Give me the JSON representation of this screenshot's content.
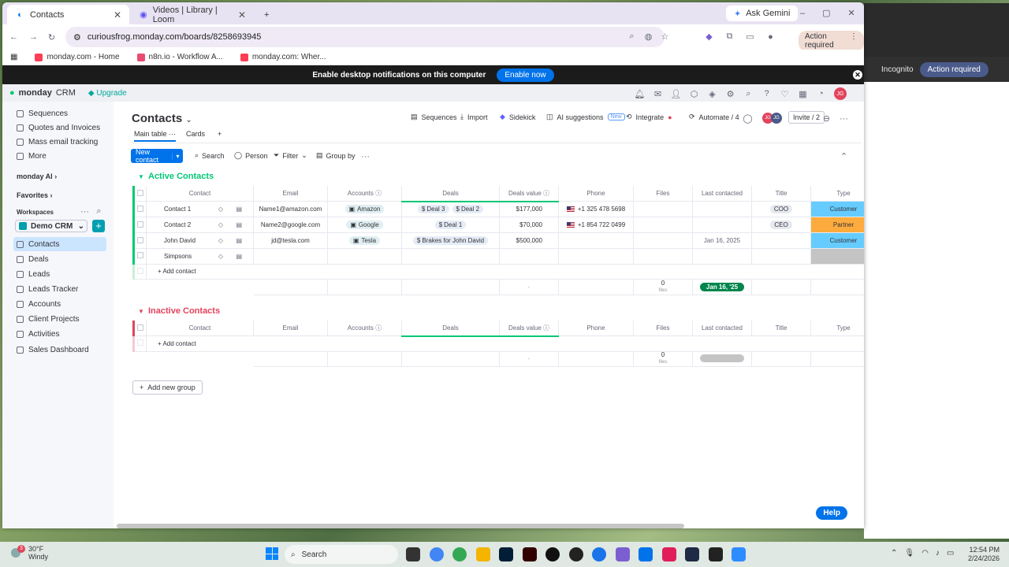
{
  "browser": {
    "tabs": [
      {
        "label": "Contacts"
      },
      {
        "label": "Videos | Library | Loom"
      }
    ],
    "ask_gemini": "Ask Gemini",
    "url": "curiousfrog.monday.com/boards/8258693945",
    "action_required": "Action required",
    "bookmarks": [
      "monday.com - Home",
      "n8n.io - Workflow A...",
      "monday.com: Wher..."
    ]
  },
  "bg_window": {
    "incognito": "Incognito",
    "action_required": "Action required"
  },
  "notification": {
    "text": "Enable desktop notifications on this computer",
    "button": "Enable now"
  },
  "app": {
    "brand": "monday",
    "brand_suffix": "CRM",
    "upgrade": "Upgrade",
    "avatar": "JG"
  },
  "sidebar": {
    "top_items": [
      "Sequences",
      "Quotes and Invoices",
      "Mass email tracking",
      "More"
    ],
    "monday_ai": "monday AI",
    "favorites": "Favorites",
    "workspaces": "Workspaces",
    "workspace_name": "Demo CRM",
    "boards": [
      "Contacts",
      "Deals",
      "Leads",
      "Leads Tracker",
      "Accounts",
      "Client Projects",
      "Activities",
      "Sales Dashboard"
    ]
  },
  "board": {
    "title": "Contacts",
    "actions": {
      "sequences": "Sequences",
      "import": "Import",
      "sidekick": "Sidekick",
      "ai": "AI suggestions",
      "new": "New",
      "integrate": "Integrate",
      "automate": "Automate / 4",
      "invite": "Invite / 2"
    },
    "views": {
      "main": "Main table",
      "cards": "Cards",
      "add": "+"
    },
    "new_contact": "New contact",
    "filters": {
      "search": "Search",
      "person": "Person",
      "filter": "Filter",
      "group_by": "Group by"
    },
    "columns": [
      "Contact",
      "Email",
      "Accounts",
      "Deals",
      "Deals value",
      "Phone",
      "Files",
      "Last contacted",
      "Title",
      "Type"
    ],
    "groups": [
      {
        "title": "Active Contacts",
        "color": "#00c875",
        "rows": [
          {
            "contact": "Contact 1",
            "email": "Name1@amazon.com",
            "account": "Amazon",
            "deals": [
              "Deal 3",
              "Deal 2"
            ],
            "value": "$177,000",
            "phone": "+1 325 478 5698",
            "last": "",
            "title": "COO",
            "type": "Customer",
            "type_color": "#66ccff"
          },
          {
            "contact": "Contact 2",
            "email": "Name2@google.com",
            "account": "Google",
            "deals": [
              "Deal 1"
            ],
            "value": "$70,000",
            "phone": "+1 854 722 0499",
            "last": "",
            "title": "CEO",
            "type": "Partner",
            "type_color": "#fdab3d"
          },
          {
            "contact": "John David",
            "email": "jd@tesla.com",
            "account": "Tesla",
            "deals": [
              "Brakes for John David"
            ],
            "value": "$500,000",
            "phone": "",
            "last": "Jan 16, 2025",
            "title": "",
            "type": "Customer",
            "type_color": "#66ccff"
          },
          {
            "contact": "Simpsons",
            "email": "",
            "account": "",
            "deals": [],
            "value": "",
            "phone": "",
            "last": "",
            "title": "",
            "type": "",
            "type_color": "#c4c4c4"
          }
        ],
        "add_label": "+ Add contact",
        "summary": {
          "value": "-",
          "files_count": "0",
          "files_label": "files",
          "date": "Jan 16, '25"
        }
      },
      {
        "title": "Inactive Contacts",
        "color": "#e2445c",
        "rows": [],
        "add_label": "+ Add contact",
        "summary": {
          "value": "-",
          "files_count": "0",
          "files_label": "files",
          "date": "-"
        }
      }
    ],
    "add_group": "Add new group",
    "help": "Help"
  },
  "taskbar": {
    "weather_temp": "30°F",
    "weather_desc": "Windy",
    "search": "Search",
    "time": "12:54 PM",
    "date": "2/24/2026",
    "badge": "3"
  }
}
